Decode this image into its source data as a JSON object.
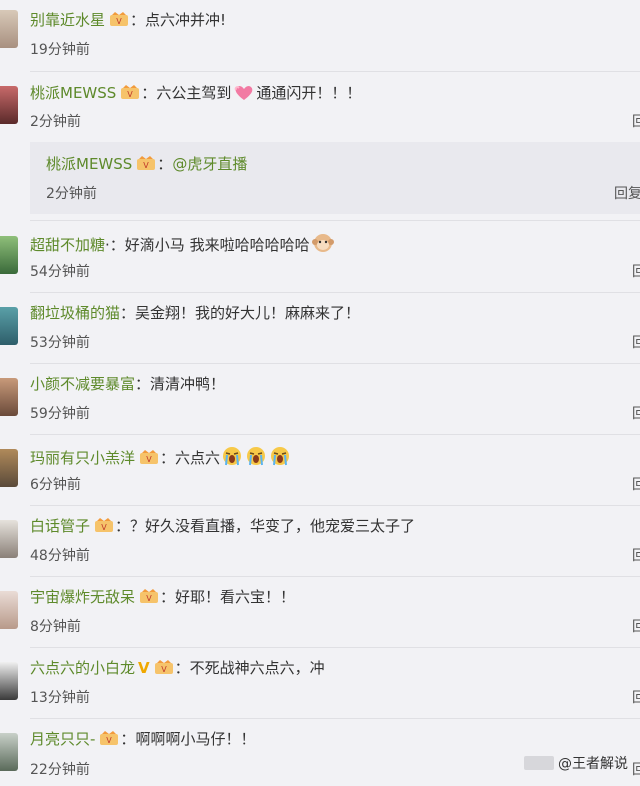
{
  "comments": [
    {
      "user": "别靠近水星",
      "text": "点六冲并冲!",
      "time": "19分钟前",
      "action": "",
      "badge": true
    },
    {
      "user": "桃派MEWSS",
      "text": "六公主驾到",
      "text2": "通通闪开！！！",
      "time": "2分钟前",
      "action": "回",
      "badge": true
    },
    {
      "user": "超甜不加糖",
      "text": "好滴小马 我来啦哈哈哈哈哈",
      "time": "54分钟前",
      "action": "回",
      "badge": false
    },
    {
      "user": "翻垃圾桶的猫",
      "text": "吴金翔！我的好大儿！麻麻来了！",
      "time": "53分钟前",
      "action": "回",
      "badge": false
    },
    {
      "user": "小颜不减要暴富",
      "text": "清清冲鸭！",
      "time": "59分钟前",
      "action": "回",
      "badge": false
    },
    {
      "user": "玛丽有只小羔洋",
      "text": "六点六",
      "time": "6分钟前",
      "action": "回",
      "badge": true
    },
    {
      "user": "白话管子",
      "text": "？好久没看直播，华变了，他宠爱三太子了",
      "time": "48分钟前",
      "action": "回",
      "badge": true
    },
    {
      "user": "宇宙爆炸无敌呆",
      "text": "好耶！看六宝！！",
      "time": "8分钟前",
      "action": "回",
      "badge": true
    },
    {
      "user": "六点六的小白龙",
      "text": "不死战神六点六，冲",
      "time": "13分钟前",
      "action": "回",
      "badge": true,
      "vip": "V"
    },
    {
      "user": "月亮只只-",
      "text": "啊啊啊小马仔！！",
      "time": "22分钟前",
      "action": "回",
      "badge": true
    }
  ],
  "reply": {
    "user": "桃派MEWSS",
    "mention": "@虎牙直播",
    "time": "2分钟前",
    "action": "回复"
  },
  "colon": "：",
  "colon_plain": "·：",
  "watermark": "@王者解说"
}
